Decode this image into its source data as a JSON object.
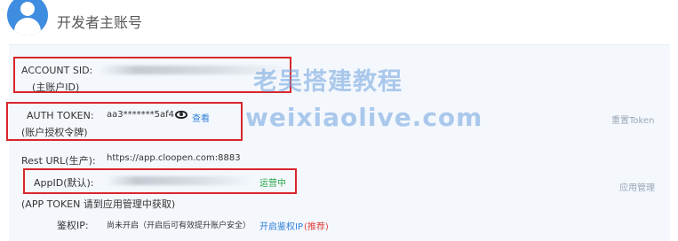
{
  "header": {
    "title": "开发者主账号"
  },
  "account_sid": {
    "label": "ACCOUNT SID:",
    "sub_label": "(主账户ID)"
  },
  "auth_token": {
    "label": "AUTH TOKEN:",
    "sub_label": "(账户授权令牌)",
    "value": "aa3*******5af4",
    "view_label": "查看",
    "reset_label": "重置Token"
  },
  "rest_url": {
    "label": "Rest URL(生产):",
    "value": "https://app.cloopen.com:8883"
  },
  "app_id": {
    "label": "AppID(默认):",
    "status": "运营中",
    "manage_label": "应用管理"
  },
  "app_token_note": "(APP TOKEN 请到应用管理中获取)",
  "auth_ip": {
    "label": "鉴权IP:",
    "value": "尚未开启（开启后可有效提升账户安全）",
    "enable_label": "开启鉴权IP",
    "recommend_label": "(推荐)"
  },
  "watermark": {
    "line1": "老吴搭建教程",
    "line2": "weixiaolive.com"
  },
  "colors": {
    "highlight": "#d9262b",
    "link": "#2f7fd6",
    "status_green": "#27a548",
    "recommend_red": "#e0423d"
  }
}
